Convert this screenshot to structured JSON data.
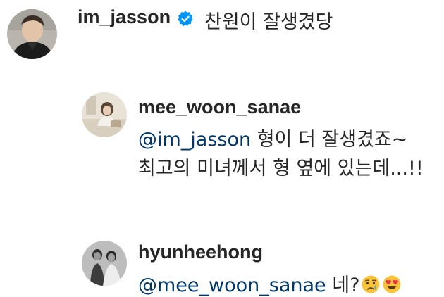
{
  "comment": {
    "username": "im_jasson",
    "verified": true,
    "text": "찬원이 잘생겼당"
  },
  "reply1": {
    "username": "mee_woon_sanae",
    "mention": "@im_jasson",
    "line1_text": " 형이 더 잘생겼죠~",
    "line2_text": "최고의 미녀께서 형 옆에 있는데...!!"
  },
  "reply2": {
    "username": "hyunheehong",
    "mention": "@mee_woon_sanae",
    "text": " 네?",
    "emojis": [
      "sad-tear-emoji",
      "heart-eyes-emoji"
    ]
  },
  "colors": {
    "text": "#262626",
    "mention": "#00376b",
    "verified_badge": "#0095f6"
  }
}
